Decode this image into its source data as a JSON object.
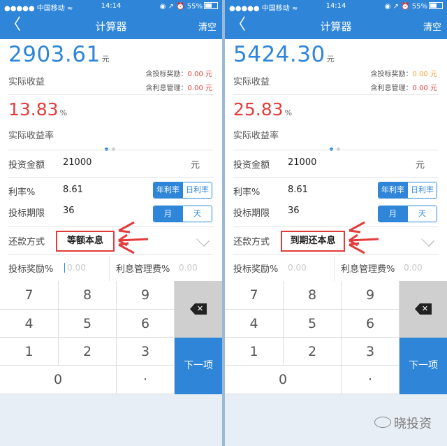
{
  "status_bar": {
    "carrier": "●●●●● 中国移动 ≈",
    "time": "14:14",
    "battery": "◉ ↗ ⏰ 55%"
  },
  "nav": {
    "back_icon": "chevron-left-icon",
    "back": "〈",
    "title": "计算器",
    "clear": "清空"
  },
  "unit_yuan": "元",
  "unit_percent": "%",
  "labels": {
    "income": "实际收益",
    "income_rate": "实际收益率",
    "bonus_prefix": "含投标奖励：",
    "mgmt_prefix": "含利息管理：",
    "investment": "投资金额",
    "rate": "利率%",
    "term": "投标期限",
    "method": "还款方式",
    "bonus_pct": "投标奖励%",
    "mgmt_fee": "利息管理费%"
  },
  "rate_seg": {
    "annual": "年利率",
    "daily": "日利率"
  },
  "term_seg": {
    "month": "月",
    "day": "天"
  },
  "placeholder": "0.00",
  "keypad": {
    "keys": [
      "7",
      "8",
      "9",
      "4",
      "5",
      "6",
      "1",
      "2",
      "3",
      "0",
      "·"
    ],
    "next": "下一项",
    "delete_icon": "backspace-icon"
  },
  "screens": [
    {
      "amount": "2903.61",
      "bonus_value": "0.00 元",
      "mgmt_value": "0.00 元",
      "rate": "13.83",
      "investment": "21000",
      "rate_value": "8.61",
      "term": "36",
      "method": "等额本息"
    },
    {
      "amount": "5424.30",
      "bonus_value": "0.00 元",
      "mgmt_value": "0.00 元",
      "rate": "25.83",
      "investment": "21000",
      "rate_value": "8.61",
      "term": "36",
      "method": "到期还本息"
    }
  ],
  "watermark": "晓投资",
  "colors": {
    "brand_blue": "#2f86d9",
    "income_red": "#e63c3c",
    "bonus_orange": "#f0a030",
    "highlight_red": "#e23b3b"
  }
}
